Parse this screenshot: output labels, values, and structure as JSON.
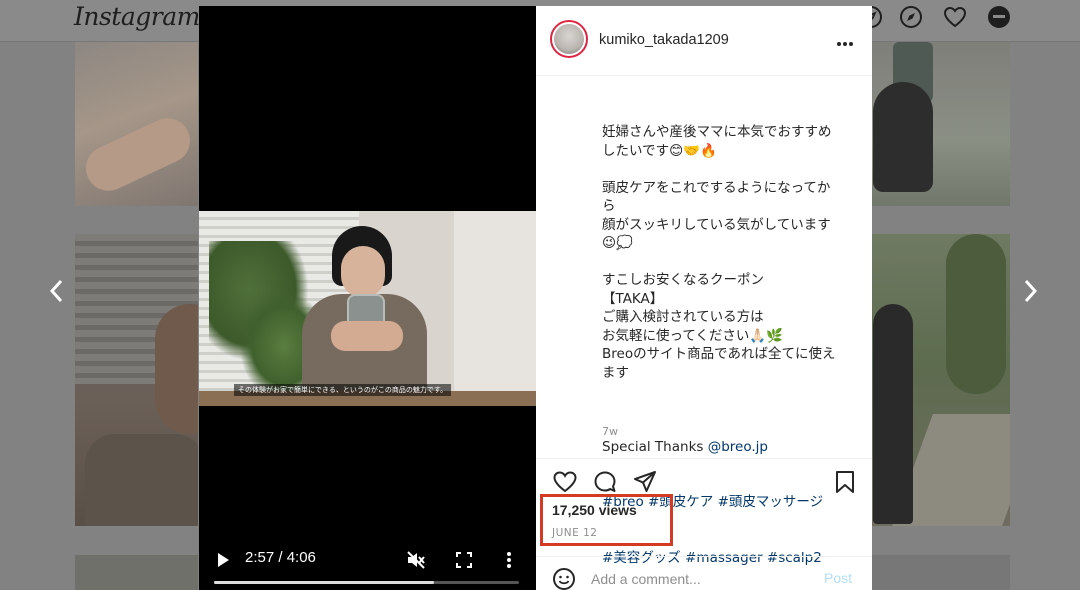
{
  "app": {
    "logo": "Instagram"
  },
  "header_icons": [
    "compass-icon",
    "heart-icon",
    "profile-icon"
  ],
  "post": {
    "username": "kumiko_takada1209",
    "caption_lines": [
      "妊婦さんや産後ママに本気でおすすめ",
      "したいです😊🤝🔥",
      "",
      "頭皮ケアをこれでするようになってか",
      "ら",
      "顔がスッキリしている気がしています",
      "😉💭",
      "",
      "すこしお安くなるクーポン",
      "【TAKA】",
      "ご購入検討されている方は",
      "お気軽に使ってください🙏🏻🌿",
      "Breoのサイト商品であれば全てに使え",
      "ます",
      ""
    ],
    "thanks_prefix": "Special Thanks ",
    "thanks_mention": "@breo.jp",
    "hashtags_line1": "#breo #頭皮ケア #頭皮マッサージ",
    "hashtags_line2": "#美容グッズ #massager #scalp2",
    "age": "7w",
    "views": "17,250 views",
    "date": "JUNE 12"
  },
  "video": {
    "subtitle": "その体験がお家で簡単にできる、というのがこの商品の魅力です。",
    "time": "2:57 / 4:06",
    "progress": 0.72
  },
  "comment": {
    "placeholder": "Add a comment...",
    "post_label": "Post"
  },
  "colors": {
    "highlight": "#d43b24",
    "link": "#00376b",
    "post_disabled": "#b2dffc"
  }
}
